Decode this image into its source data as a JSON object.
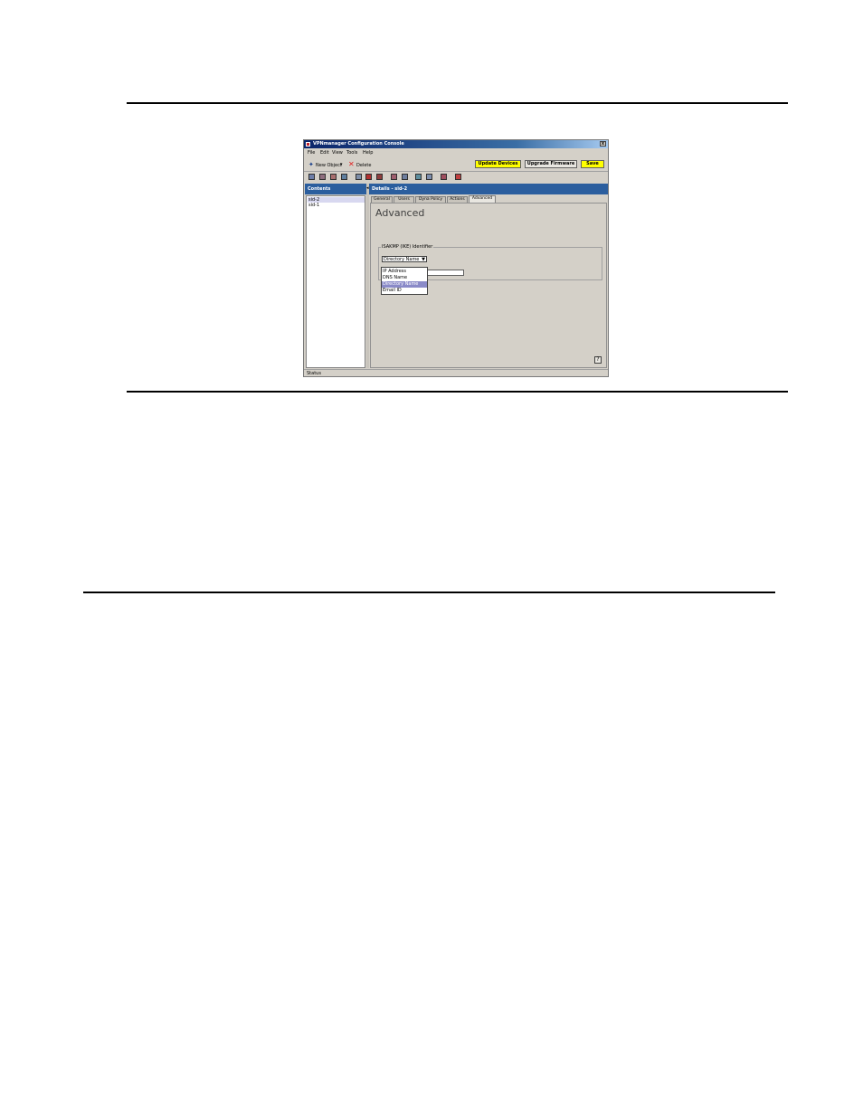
{
  "window": {
    "title": "VPNmanager Configuration Console",
    "close_glyph": "x"
  },
  "menu": [
    "File",
    "Edit",
    "View",
    "Tools",
    "Help"
  ],
  "toolbar": {
    "new_label": "New Object",
    "new_arrow": "▾",
    "delete_label": "Delete",
    "update_devices": "Update Devices",
    "upgrade_firmware": "Upgrade Firmware",
    "save": "Save"
  },
  "toolbar_icons": [
    "toolbar-icon-1",
    "toolbar-icon-2",
    "toolbar-icon-3",
    "toolbar-icon-4",
    "toolbar-icon-5",
    "toolbar-icon-6",
    "toolbar-icon-7",
    "toolbar-icon-8",
    "toolbar-icon-9",
    "toolbar-icon-10",
    "toolbar-icon-11",
    "toolbar-icon-12",
    "toolbar-icon-13"
  ],
  "contents": {
    "header": "Contents",
    "items": [
      "sid-2",
      "sid-1"
    ]
  },
  "details": {
    "header": "Details - sid-2",
    "tabs": [
      "General",
      "Users",
      "Dyna Policy",
      "Actions",
      "Advanced"
    ],
    "active_tab": "Advanced",
    "title": "Advanced",
    "group_label": "ISAKMP (IKE) Identifier",
    "combo_value": "Directory Name",
    "dropdown_options": [
      "IP Address",
      "DNS Name",
      "Directory Name",
      "Email ID"
    ],
    "selected_option": "Directory Name",
    "help_glyph": "?"
  },
  "status": {
    "text": "Status"
  },
  "colors": {
    "accent": "#2b5e9e",
    "highlight_button": "#ffff00",
    "window_bg": "#d4d0c8"
  }
}
